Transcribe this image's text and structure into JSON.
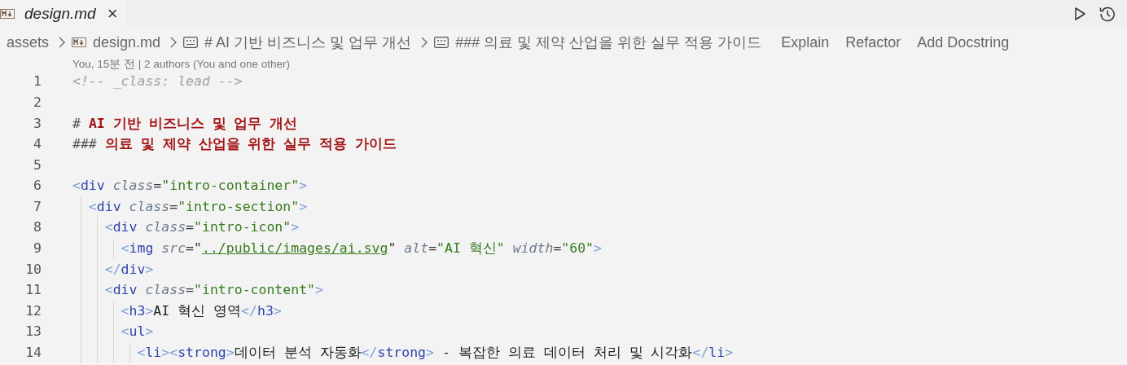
{
  "tab": {
    "label": "design.md",
    "preview": true,
    "close": "×"
  },
  "breadcrumbs": [
    {
      "label": "assets",
      "kind": "folder"
    },
    {
      "label": "design.md",
      "kind": "markdown"
    },
    {
      "label": "# AI 기반 비즈니스 및 업무 개선",
      "kind": "symbol"
    },
    {
      "label": "### 의료 및 제약 산업을 위한 실무 적용 가이드",
      "kind": "symbol"
    }
  ],
  "actions": [
    "Explain",
    "Refactor",
    "Add Docstring"
  ],
  "blame": "You, 15분 전 | 2 authors (You and one other)",
  "lines": [
    {
      "number": "1",
      "tokens": [
        {
          "kind": "comment",
          "text": "<!-- _class: lead -->"
        }
      ]
    },
    {
      "number": "2"
    },
    {
      "number": "3",
      "tokens": [
        {
          "kind": "hmark",
          "text": "# "
        },
        {
          "kind": "heading",
          "text": "AI 기반 비즈니스 및 업무 개선"
        }
      ]
    },
    {
      "number": "4",
      "tokens": [
        {
          "kind": "hmark",
          "text": "### "
        },
        {
          "kind": "heading",
          "text": "의료 및 제약 산업을 위한 실무 적용 가이드"
        }
      ]
    },
    {
      "number": "5"
    },
    {
      "number": "6",
      "tokens": [
        {
          "kind": "bracket",
          "text": "<"
        },
        {
          "kind": "tag",
          "text": "div"
        },
        {
          "kind": "attr",
          "text": " class"
        },
        {
          "kind": "op",
          "text": "="
        },
        {
          "kind": "string",
          "text": "\"intro-container\""
        },
        {
          "kind": "bracket",
          "text": ">"
        }
      ]
    },
    {
      "number": "7",
      "tokens": [
        {
          "kind": "bracket",
          "text": "  <"
        },
        {
          "kind": "tag",
          "text": "div"
        },
        {
          "kind": "attr",
          "text": " class"
        },
        {
          "kind": "op",
          "text": "="
        },
        {
          "kind": "string",
          "text": "\"intro-section\""
        },
        {
          "kind": "bracket",
          "text": ">"
        }
      ]
    },
    {
      "number": "8",
      "tokens": [
        {
          "kind": "bracket",
          "text": "    <"
        },
        {
          "kind": "tag",
          "text": "div"
        },
        {
          "kind": "attr",
          "text": " class"
        },
        {
          "kind": "op",
          "text": "="
        },
        {
          "kind": "string",
          "text": "\"intro-icon\""
        },
        {
          "kind": "bracket",
          "text": ">"
        }
      ]
    },
    {
      "number": "9",
      "tokens": [
        {
          "kind": "bracket",
          "text": "      <"
        },
        {
          "kind": "tag",
          "text": "img"
        },
        {
          "kind": "attr",
          "text": " src"
        },
        {
          "kind": "op",
          "text": "=\""
        },
        {
          "kind": "link",
          "text": "../public/images/ai.svg"
        },
        {
          "kind": "op",
          "text": "\""
        },
        {
          "kind": "attr",
          "text": " alt"
        },
        {
          "kind": "op",
          "text": "="
        },
        {
          "kind": "string",
          "text": "\"AI 혁신\""
        },
        {
          "kind": "attr",
          "text": " width"
        },
        {
          "kind": "op",
          "text": "="
        },
        {
          "kind": "string",
          "text": "\"60\""
        },
        {
          "kind": "bracket",
          "text": ">"
        }
      ]
    },
    {
      "number": "10",
      "tokens": [
        {
          "kind": "bracket",
          "text": "    </"
        },
        {
          "kind": "tag",
          "text": "div"
        },
        {
          "kind": "bracket",
          "text": ">"
        }
      ]
    },
    {
      "number": "11",
      "tokens": [
        {
          "kind": "bracket",
          "text": "    <"
        },
        {
          "kind": "tag",
          "text": "div"
        },
        {
          "kind": "attr",
          "text": " class"
        },
        {
          "kind": "op",
          "text": "="
        },
        {
          "kind": "string",
          "text": "\"intro-content\""
        },
        {
          "kind": "bracket",
          "text": ">"
        }
      ]
    },
    {
      "number": "12",
      "tokens": [
        {
          "kind": "bracket",
          "text": "      <"
        },
        {
          "kind": "tag",
          "text": "h3"
        },
        {
          "kind": "bracket",
          "text": ">"
        },
        {
          "kind": "text",
          "text": "AI 혁신 영역"
        },
        {
          "kind": "bracket",
          "text": "</"
        },
        {
          "kind": "tag",
          "text": "h3"
        },
        {
          "kind": "bracket",
          "text": ">"
        }
      ]
    },
    {
      "number": "13",
      "tokens": [
        {
          "kind": "bracket",
          "text": "      <"
        },
        {
          "kind": "tag",
          "text": "ul"
        },
        {
          "kind": "bracket",
          "text": ">"
        }
      ]
    },
    {
      "number": "14",
      "tokens": [
        {
          "kind": "bracket",
          "text": "        <"
        },
        {
          "kind": "tag",
          "text": "li"
        },
        {
          "kind": "bracket",
          "text": "><"
        },
        {
          "kind": "tag",
          "text": "strong"
        },
        {
          "kind": "bracket",
          "text": ">"
        },
        {
          "kind": "text",
          "text": "데이터 분석 자동화"
        },
        {
          "kind": "bracket",
          "text": "</"
        },
        {
          "kind": "tag",
          "text": "strong"
        },
        {
          "kind": "bracket",
          "text": ">"
        },
        {
          "kind": "text",
          "text": " - 복잡한 의료 데이터 처리 및 시각화"
        },
        {
          "kind": "bracket",
          "text": "</"
        },
        {
          "kind": "tag",
          "text": "li"
        },
        {
          "kind": "bracket",
          "text": ">"
        }
      ]
    }
  ]
}
